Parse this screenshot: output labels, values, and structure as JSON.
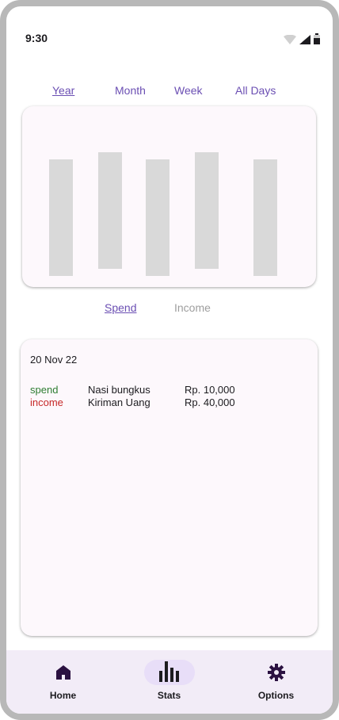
{
  "status_bar": {
    "time": "9:30",
    "icons": [
      "wifi-icon",
      "signal-icon",
      "battery-icon"
    ]
  },
  "period_tabs": [
    {
      "label": "Year",
      "active": true
    },
    {
      "label": "Month",
      "active": false
    },
    {
      "label": "Week",
      "active": false
    },
    {
      "label": "All Days",
      "active": false
    }
  ],
  "chart_data": {
    "type": "bar",
    "categories": [
      "",
      "",
      "",
      "",
      ""
    ],
    "values": [
      147,
      147,
      147,
      147,
      147
    ],
    "title": "",
    "xlabel": "",
    "ylabel": ""
  },
  "view_toggle": {
    "spend_label": "Spend",
    "income_label": "Income",
    "active": "spend"
  },
  "transactions": {
    "date": "20 Nov 22",
    "rows": [
      {
        "type": "spend",
        "description": "Nasi bungkus",
        "amount": "Rp. 10,000"
      },
      {
        "type": "income",
        "description": "Kiriman Uang",
        "amount": "Rp. 40,000"
      }
    ]
  },
  "bottom_nav": {
    "items": [
      {
        "label": "Home",
        "icon": "home-icon",
        "active": false
      },
      {
        "label": "Stats",
        "icon": "bar-chart-icon",
        "active": true
      },
      {
        "label": "Options",
        "icon": "gear-icon",
        "active": false
      }
    ]
  },
  "colors": {
    "accent": "#6b4fb3",
    "spend": "#2e7d32",
    "income": "#c62828",
    "inactive_toggle": "#9e9e9e",
    "nav_bg": "#f2ecf7",
    "icon_dark": "#2b1141"
  }
}
